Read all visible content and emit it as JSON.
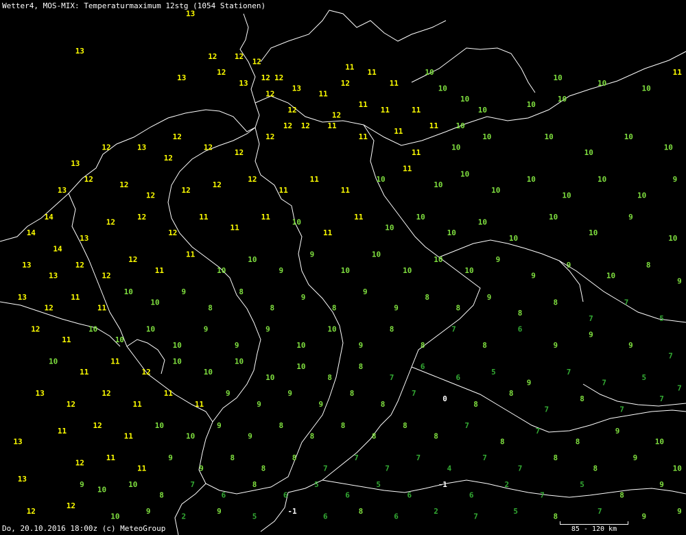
{
  "header": {
    "title": "Wetter4, MOS-MIX: Temperaturmaximum 12stg (1054 Stationen)"
  },
  "footer": {
    "timestamp": "Do, 20.10.2016 18:00z (c) MeteoGroup",
    "scale_label": "85 - 120 km"
  },
  "colors": {
    "background": "#000000",
    "border": "#ffffff",
    "warm": "#ffff00",
    "mild": "#7fdf3f",
    "cool": "#33aa33",
    "cold": "#ffffff"
  },
  "legend_note": "",
  "stations": [
    {
      "lon": 6.2,
      "lat": 55.9,
      "t": 12
    },
    {
      "lon": 7.7,
      "lat": 55.7,
      "t": 13
    },
    {
      "lon": 5.2,
      "lat": 55.0,
      "t": 13
    },
    {
      "lon": 7.5,
      "lat": 54.5,
      "t": 13
    },
    {
      "lon": 8.2,
      "lat": 54.9,
      "t": 12
    },
    {
      "lon": 8.8,
      "lat": 54.9,
      "t": 12
    },
    {
      "lon": 8.4,
      "lat": 54.6,
      "t": 12
    },
    {
      "lon": 8.9,
      "lat": 54.4,
      "t": 13
    },
    {
      "lon": 9.2,
      "lat": 54.8,
      "t": 12
    },
    {
      "lon": 9.4,
      "lat": 54.5,
      "t": 12
    },
    {
      "lon": 9.7,
      "lat": 54.5,
      "t": 12
    },
    {
      "lon": 10.1,
      "lat": 54.3,
      "t": 13
    },
    {
      "lon": 9.5,
      "lat": 54.2,
      "t": 12
    },
    {
      "lon": 10.0,
      "lat": 53.9,
      "t": 12
    },
    {
      "lon": 11.2,
      "lat": 54.4,
      "t": 12
    },
    {
      "lon": 11.0,
      "lat": 53.8,
      "t": 12
    },
    {
      "lon": 11.6,
      "lat": 54.0,
      "t": 11
    },
    {
      "lon": 10.7,
      "lat": 54.2,
      "t": 11
    },
    {
      "lon": 11.3,
      "lat": 54.7,
      "t": 11
    },
    {
      "lon": 11.8,
      "lat": 54.6,
      "t": 11
    },
    {
      "lon": 12.3,
      "lat": 54.4,
      "t": 11
    },
    {
      "lon": 13.1,
      "lat": 54.6,
      "t": 10
    },
    {
      "lon": 13.4,
      "lat": 54.3,
      "t": 10
    },
    {
      "lon": 13.9,
      "lat": 54.1,
      "t": 10
    },
    {
      "lon": 14.3,
      "lat": 53.9,
      "t": 10
    },
    {
      "lon": 12.1,
      "lat": 53.9,
      "t": 11
    },
    {
      "lon": 12.8,
      "lat": 53.9,
      "t": 11
    },
    {
      "lon": 13.2,
      "lat": 53.6,
      "t": 11
    },
    {
      "lon": 12.4,
      "lat": 53.5,
      "t": 11
    },
    {
      "lon": 13.8,
      "lat": 53.6,
      "t": 10
    },
    {
      "lon": 14.4,
      "lat": 53.4,
      "t": 10
    },
    {
      "lon": 13.7,
      "lat": 53.2,
      "t": 10
    },
    {
      "lon": 12.8,
      "lat": 53.1,
      "t": 11
    },
    {
      "lon": 11.6,
      "lat": 53.4,
      "t": 11
    },
    {
      "lon": 10.9,
      "lat": 53.6,
      "t": 11
    },
    {
      "lon": 10.3,
      "lat": 53.6,
      "t": 12
    },
    {
      "lon": 9.9,
      "lat": 53.6,
      "t": 12
    },
    {
      "lon": 9.5,
      "lat": 53.4,
      "t": 12
    },
    {
      "lon": 8.8,
      "lat": 53.1,
      "t": 12
    },
    {
      "lon": 8.1,
      "lat": 53.2,
      "t": 12
    },
    {
      "lon": 7.4,
      "lat": 53.4,
      "t": 12
    },
    {
      "lon": 7.2,
      "lat": 53.0,
      "t": 12
    },
    {
      "lon": 6.6,
      "lat": 53.2,
      "t": 13
    },
    {
      "lon": 5.8,
      "lat": 53.2,
      "t": 12
    },
    {
      "lon": 5.1,
      "lat": 52.9,
      "t": 13
    },
    {
      "lon": 4.8,
      "lat": 52.4,
      "t": 13
    },
    {
      "lon": 5.4,
      "lat": 52.6,
      "t": 12
    },
    {
      "lon": 6.2,
      "lat": 52.5,
      "t": 12
    },
    {
      "lon": 6.8,
      "lat": 52.3,
      "t": 12
    },
    {
      "lon": 7.6,
      "lat": 52.4,
      "t": 12
    },
    {
      "lon": 8.3,
      "lat": 52.5,
      "t": 12
    },
    {
      "lon": 9.1,
      "lat": 52.6,
      "t": 12
    },
    {
      "lon": 9.8,
      "lat": 52.4,
      "t": 11
    },
    {
      "lon": 10.5,
      "lat": 52.6,
      "t": 11
    },
    {
      "lon": 11.2,
      "lat": 52.4,
      "t": 11
    },
    {
      "lon": 12.0,
      "lat": 52.6,
      "t": 10
    },
    {
      "lon": 12.6,
      "lat": 52.8,
      "t": 11
    },
    {
      "lon": 13.3,
      "lat": 52.5,
      "t": 10
    },
    {
      "lon": 13.9,
      "lat": 52.7,
      "t": 10
    },
    {
      "lon": 14.6,
      "lat": 52.4,
      "t": 10
    },
    {
      "lon": 15.4,
      "lat": 52.6,
      "t": 10
    },
    {
      "lon": 16.2,
      "lat": 52.3,
      "t": 10
    },
    {
      "lon": 17.0,
      "lat": 52.6,
      "t": 10
    },
    {
      "lon": 17.9,
      "lat": 52.3,
      "t": 10
    },
    {
      "lon": 18.7,
      "lat": 52.6,
      "t": 9
    },
    {
      "lon": 15.8,
      "lat": 53.4,
      "t": 10
    },
    {
      "lon": 16.7,
      "lat": 53.1,
      "t": 10
    },
    {
      "lon": 17.6,
      "lat": 53.4,
      "t": 10
    },
    {
      "lon": 18.5,
      "lat": 53.2,
      "t": 10
    },
    {
      "lon": 18.9,
      "lat": 53.7,
      "t": 9
    },
    {
      "lon": 16.1,
      "lat": 54.1,
      "t": 10
    },
    {
      "lon": 17.0,
      "lat": 54.4,
      "t": 10
    },
    {
      "lon": 18.0,
      "lat": 54.3,
      "t": 10
    },
    {
      "lon": 18.7,
      "lat": 54.6,
      "t": 11
    },
    {
      "lon": 15.4,
      "lat": 54.0,
      "t": 10
    },
    {
      "lon": 16.0,
      "lat": 54.5,
      "t": 10
    },
    {
      "lon": 4.5,
      "lat": 51.9,
      "t": 14
    },
    {
      "lon": 4.1,
      "lat": 51.6,
      "t": 14
    },
    {
      "lon": 4.7,
      "lat": 51.3,
      "t": 14
    },
    {
      "lon": 5.3,
      "lat": 51.5,
      "t": 13
    },
    {
      "lon": 5.9,
      "lat": 51.8,
      "t": 12
    },
    {
      "lon": 6.6,
      "lat": 51.9,
      "t": 12
    },
    {
      "lon": 7.3,
      "lat": 51.6,
      "t": 12
    },
    {
      "lon": 8.0,
      "lat": 51.9,
      "t": 11
    },
    {
      "lon": 8.7,
      "lat": 51.7,
      "t": 11
    },
    {
      "lon": 9.4,
      "lat": 51.9,
      "t": 11
    },
    {
      "lon": 10.1,
      "lat": 51.8,
      "t": 10
    },
    {
      "lon": 10.8,
      "lat": 51.6,
      "t": 11
    },
    {
      "lon": 11.5,
      "lat": 51.9,
      "t": 11
    },
    {
      "lon": 12.2,
      "lat": 51.7,
      "t": 10
    },
    {
      "lon": 12.9,
      "lat": 51.9,
      "t": 10
    },
    {
      "lon": 13.6,
      "lat": 51.6,
      "t": 10
    },
    {
      "lon": 14.3,
      "lat": 51.8,
      "t": 10
    },
    {
      "lon": 15.0,
      "lat": 51.5,
      "t": 10
    },
    {
      "lon": 15.9,
      "lat": 51.9,
      "t": 10
    },
    {
      "lon": 16.8,
      "lat": 51.6,
      "t": 10
    },
    {
      "lon": 17.7,
      "lat": 51.9,
      "t": 9
    },
    {
      "lon": 18.6,
      "lat": 51.5,
      "t": 10
    },
    {
      "lon": 4.0,
      "lat": 51.0,
      "t": 13
    },
    {
      "lon": 4.6,
      "lat": 50.8,
      "t": 13
    },
    {
      "lon": 5.2,
      "lat": 51.0,
      "t": 12
    },
    {
      "lon": 5.8,
      "lat": 50.8,
      "t": 12
    },
    {
      "lon": 6.4,
      "lat": 51.1,
      "t": 12
    },
    {
      "lon": 7.0,
      "lat": 50.9,
      "t": 11
    },
    {
      "lon": 7.7,
      "lat": 51.2,
      "t": 11
    },
    {
      "lon": 8.4,
      "lat": 50.9,
      "t": 10
    },
    {
      "lon": 9.1,
      "lat": 51.1,
      "t": 10
    },
    {
      "lon": 9.8,
      "lat": 50.9,
      "t": 9
    },
    {
      "lon": 10.5,
      "lat": 51.2,
      "t": 9
    },
    {
      "lon": 11.2,
      "lat": 50.9,
      "t": 10
    },
    {
      "lon": 11.9,
      "lat": 51.2,
      "t": 10
    },
    {
      "lon": 12.6,
      "lat": 50.9,
      "t": 10
    },
    {
      "lon": 13.3,
      "lat": 51.1,
      "t": 10
    },
    {
      "lon": 14.0,
      "lat": 50.9,
      "t": 10
    },
    {
      "lon": 14.7,
      "lat": 51.1,
      "t": 9
    },
    {
      "lon": 15.5,
      "lat": 50.8,
      "t": 9
    },
    {
      "lon": 16.3,
      "lat": 51.0,
      "t": 9
    },
    {
      "lon": 17.2,
      "lat": 50.8,
      "t": 10
    },
    {
      "lon": 18.1,
      "lat": 51.0,
      "t": 8
    },
    {
      "lon": 18.8,
      "lat": 50.7,
      "t": 9
    },
    {
      "lon": 3.9,
      "lat": 50.4,
      "t": 13
    },
    {
      "lon": 4.5,
      "lat": 50.2,
      "t": 12
    },
    {
      "lon": 5.1,
      "lat": 50.4,
      "t": 11
    },
    {
      "lon": 5.7,
      "lat": 50.2,
      "t": 11
    },
    {
      "lon": 6.3,
      "lat": 50.5,
      "t": 10
    },
    {
      "lon": 6.9,
      "lat": 50.3,
      "t": 10
    },
    {
      "lon": 7.6,
      "lat": 50.5,
      "t": 9
    },
    {
      "lon": 8.2,
      "lat": 50.2,
      "t": 8
    },
    {
      "lon": 8.9,
      "lat": 50.5,
      "t": 8
    },
    {
      "lon": 9.6,
      "lat": 50.2,
      "t": 8
    },
    {
      "lon": 10.3,
      "lat": 50.4,
      "t": 9
    },
    {
      "lon": 11.0,
      "lat": 50.2,
      "t": 8
    },
    {
      "lon": 11.7,
      "lat": 50.5,
      "t": 9
    },
    {
      "lon": 12.4,
      "lat": 50.2,
      "t": 9
    },
    {
      "lon": 13.1,
      "lat": 50.4,
      "t": 8
    },
    {
      "lon": 13.8,
      "lat": 50.2,
      "t": 8
    },
    {
      "lon": 14.5,
      "lat": 50.4,
      "t": 9
    },
    {
      "lon": 15.2,
      "lat": 50.1,
      "t": 8
    },
    {
      "lon": 16.0,
      "lat": 50.3,
      "t": 8
    },
    {
      "lon": 16.8,
      "lat": 50.0,
      "t": 7
    },
    {
      "lon": 17.6,
      "lat": 50.3,
      "t": 7
    },
    {
      "lon": 18.4,
      "lat": 50.0,
      "t": 5
    },
    {
      "lon": 18.9,
      "lat": 49.8,
      "t": 7
    },
    {
      "lon": 4.2,
      "lat": 49.8,
      "t": 12
    },
    {
      "lon": 4.9,
      "lat": 49.6,
      "t": 11
    },
    {
      "lon": 5.5,
      "lat": 49.8,
      "t": 10
    },
    {
      "lon": 6.1,
      "lat": 49.6,
      "t": 10
    },
    {
      "lon": 6.8,
      "lat": 49.8,
      "t": 10
    },
    {
      "lon": 7.4,
      "lat": 49.5,
      "t": 10
    },
    {
      "lon": 8.1,
      "lat": 49.8,
      "t": 9
    },
    {
      "lon": 8.8,
      "lat": 49.5,
      "t": 9
    },
    {
      "lon": 9.5,
      "lat": 49.8,
      "t": 9
    },
    {
      "lon": 10.2,
      "lat": 49.5,
      "t": 10
    },
    {
      "lon": 10.9,
      "lat": 49.8,
      "t": 10
    },
    {
      "lon": 11.6,
      "lat": 49.5,
      "t": 9
    },
    {
      "lon": 12.3,
      "lat": 49.8,
      "t": 8
    },
    {
      "lon": 13.0,
      "lat": 49.5,
      "t": 8
    },
    {
      "lon": 13.7,
      "lat": 49.8,
      "t": 7
    },
    {
      "lon": 14.4,
      "lat": 49.5,
      "t": 8
    },
    {
      "lon": 15.2,
      "lat": 49.8,
      "t": 6
    },
    {
      "lon": 16.0,
      "lat": 49.5,
      "t": 9
    },
    {
      "lon": 16.8,
      "lat": 49.7,
      "t": 9
    },
    {
      "lon": 17.7,
      "lat": 49.5,
      "t": 9
    },
    {
      "lon": 18.6,
      "lat": 49.3,
      "t": 7
    },
    {
      "lon": 4.6,
      "lat": 49.2,
      "t": 10
    },
    {
      "lon": 5.3,
      "lat": 49.0,
      "t": 11
    },
    {
      "lon": 6.0,
      "lat": 49.2,
      "t": 11
    },
    {
      "lon": 6.7,
      "lat": 49.0,
      "t": 12
    },
    {
      "lon": 7.4,
      "lat": 49.2,
      "t": 10
    },
    {
      "lon": 8.1,
      "lat": 49.0,
      "t": 10
    },
    {
      "lon": 8.8,
      "lat": 49.2,
      "t": 10
    },
    {
      "lon": 9.5,
      "lat": 48.9,
      "t": 10
    },
    {
      "lon": 10.2,
      "lat": 49.1,
      "t": 10
    },
    {
      "lon": 10.9,
      "lat": 48.9,
      "t": 8
    },
    {
      "lon": 11.6,
      "lat": 49.1,
      "t": 8
    },
    {
      "lon": 12.3,
      "lat": 48.9,
      "t": 7
    },
    {
      "lon": 13.0,
      "lat": 49.1,
      "t": 6
    },
    {
      "lon": 13.8,
      "lat": 48.9,
      "t": 6
    },
    {
      "lon": 14.6,
      "lat": 49.0,
      "t": 5
    },
    {
      "lon": 15.4,
      "lat": 48.8,
      "t": 9
    },
    {
      "lon": 16.3,
      "lat": 49.0,
      "t": 7
    },
    {
      "lon": 17.1,
      "lat": 48.8,
      "t": 7
    },
    {
      "lon": 18.0,
      "lat": 48.9,
      "t": 5
    },
    {
      "lon": 18.8,
      "lat": 48.7,
      "t": 7
    },
    {
      "lon": 4.3,
      "lat": 48.6,
      "t": 13
    },
    {
      "lon": 5.0,
      "lat": 48.4,
      "t": 12
    },
    {
      "lon": 5.8,
      "lat": 48.6,
      "t": 12
    },
    {
      "lon": 6.5,
      "lat": 48.4,
      "t": 11
    },
    {
      "lon": 7.2,
      "lat": 48.6,
      "t": 11
    },
    {
      "lon": 7.9,
      "lat": 48.4,
      "t": 11
    },
    {
      "lon": 8.6,
      "lat": 48.6,
      "t": 9
    },
    {
      "lon": 9.3,
      "lat": 48.4,
      "t": 9
    },
    {
      "lon": 10.0,
      "lat": 48.6,
      "t": 9
    },
    {
      "lon": 10.7,
      "lat": 48.4,
      "t": 9
    },
    {
      "lon": 11.4,
      "lat": 48.6,
      "t": 8
    },
    {
      "lon": 12.1,
      "lat": 48.4,
      "t": 8
    },
    {
      "lon": 12.8,
      "lat": 48.6,
      "t": 7
    },
    {
      "lon": 13.5,
      "lat": 48.5,
      "t": 0
    },
    {
      "lon": 14.2,
      "lat": 48.4,
      "t": 8
    },
    {
      "lon": 15.0,
      "lat": 48.6,
      "t": 8
    },
    {
      "lon": 15.8,
      "lat": 48.3,
      "t": 7
    },
    {
      "lon": 16.6,
      "lat": 48.5,
      "t": 8
    },
    {
      "lon": 17.5,
      "lat": 48.3,
      "t": 7
    },
    {
      "lon": 18.4,
      "lat": 48.5,
      "t": 7
    },
    {
      "lon": 4.8,
      "lat": 47.9,
      "t": 11
    },
    {
      "lon": 5.6,
      "lat": 48.0,
      "t": 12
    },
    {
      "lon": 6.3,
      "lat": 47.8,
      "t": 11
    },
    {
      "lon": 7.0,
      "lat": 48.0,
      "t": 10
    },
    {
      "lon": 7.7,
      "lat": 47.8,
      "t": 10
    },
    {
      "lon": 8.4,
      "lat": 48.0,
      "t": 9
    },
    {
      "lon": 9.1,
      "lat": 47.8,
      "t": 9
    },
    {
      "lon": 9.8,
      "lat": 48.0,
      "t": 8
    },
    {
      "lon": 10.5,
      "lat": 47.8,
      "t": 8
    },
    {
      "lon": 11.2,
      "lat": 48.0,
      "t": 8
    },
    {
      "lon": 11.9,
      "lat": 47.8,
      "t": 8
    },
    {
      "lon": 12.6,
      "lat": 48.0,
      "t": 8
    },
    {
      "lon": 13.3,
      "lat": 47.8,
      "t": 8
    },
    {
      "lon": 14.0,
      "lat": 48.0,
      "t": 7
    },
    {
      "lon": 14.8,
      "lat": 47.7,
      "t": 8
    },
    {
      "lon": 15.6,
      "lat": 47.9,
      "t": 7
    },
    {
      "lon": 16.5,
      "lat": 47.7,
      "t": 8
    },
    {
      "lon": 17.4,
      "lat": 47.9,
      "t": 9
    },
    {
      "lon": 18.3,
      "lat": 47.7,
      "t": 10
    },
    {
      "lon": 18.9,
      "lat": 47.9,
      "t": 9
    },
    {
      "lon": 5.2,
      "lat": 47.3,
      "t": 12
    },
    {
      "lon": 5.9,
      "lat": 47.4,
      "t": 11
    },
    {
      "lon": 6.6,
      "lat": 47.2,
      "t": 11
    },
    {
      "lon": 7.3,
      "lat": 47.4,
      "t": 9
    },
    {
      "lon": 8.0,
      "lat": 47.2,
      "t": 9
    },
    {
      "lon": 8.7,
      "lat": 47.4,
      "t": 8
    },
    {
      "lon": 9.4,
      "lat": 47.2,
      "t": 8
    },
    {
      "lon": 10.1,
      "lat": 47.4,
      "t": 8
    },
    {
      "lon": 10.8,
      "lat": 47.2,
      "t": 7
    },
    {
      "lon": 11.5,
      "lat": 47.4,
      "t": 7
    },
    {
      "lon": 12.2,
      "lat": 47.2,
      "t": 7
    },
    {
      "lon": 12.9,
      "lat": 47.4,
      "t": 7
    },
    {
      "lon": 13.6,
      "lat": 47.2,
      "t": 4
    },
    {
      "lon": 14.4,
      "lat": 47.4,
      "t": 7
    },
    {
      "lon": 15.2,
      "lat": 47.2,
      "t": 7
    },
    {
      "lon": 16.0,
      "lat": 47.4,
      "t": 8
    },
    {
      "lon": 16.9,
      "lat": 47.2,
      "t": 8
    },
    {
      "lon": 17.8,
      "lat": 47.4,
      "t": 9
    },
    {
      "lon": 18.7,
      "lat": 47.2,
      "t": 10
    },
    {
      "lon": 5.7,
      "lat": 46.8,
      "t": 10
    },
    {
      "lon": 6.4,
      "lat": 46.9,
      "t": 10
    },
    {
      "lon": 7.1,
      "lat": 46.7,
      "t": 8
    },
    {
      "lon": 7.8,
      "lat": 46.9,
      "t": 7
    },
    {
      "lon": 8.5,
      "lat": 46.7,
      "t": 6
    },
    {
      "lon": 9.2,
      "lat": 46.9,
      "t": 8
    },
    {
      "lon": 9.9,
      "lat": 46.7,
      "t": 6
    },
    {
      "lon": 10.6,
      "lat": 46.9,
      "t": 5
    },
    {
      "lon": 11.3,
      "lat": 46.7,
      "t": 6
    },
    {
      "lon": 12.0,
      "lat": 46.9,
      "t": 5
    },
    {
      "lon": 12.7,
      "lat": 46.7,
      "t": 6
    },
    {
      "lon": 13.4,
      "lat": 46.9,
      "t": -1
    },
    {
      "lon": 14.1,
      "lat": 46.7,
      "t": 6
    },
    {
      "lon": 14.9,
      "lat": 46.9,
      "t": 2
    },
    {
      "lon": 15.7,
      "lat": 46.7,
      "t": 7
    },
    {
      "lon": 16.6,
      "lat": 46.9,
      "t": 5
    },
    {
      "lon": 17.5,
      "lat": 46.7,
      "t": 8
    },
    {
      "lon": 18.4,
      "lat": 46.9,
      "t": 9
    },
    {
      "lon": 6.0,
      "lat": 46.3,
      "t": 10
    },
    {
      "lon": 6.8,
      "lat": 46.4,
      "t": 9
    },
    {
      "lon": 7.6,
      "lat": 46.3,
      "t": 2
    },
    {
      "lon": 8.4,
      "lat": 46.4,
      "t": 9
    },
    {
      "lon": 9.2,
      "lat": 46.3,
      "t": 5
    },
    {
      "lon": 10.0,
      "lat": 46.4,
      "t": -1
    },
    {
      "lon": 10.8,
      "lat": 46.3,
      "t": 6
    },
    {
      "lon": 11.6,
      "lat": 46.4,
      "t": 8
    },
    {
      "lon": 12.4,
      "lat": 46.3,
      "t": 6
    },
    {
      "lon": 13.3,
      "lat": 46.4,
      "t": 2
    },
    {
      "lon": 14.2,
      "lat": 46.3,
      "t": 7
    },
    {
      "lon": 15.1,
      "lat": 46.4,
      "t": 5
    },
    {
      "lon": 16.0,
      "lat": 46.3,
      "t": 8
    },
    {
      "lon": 17.0,
      "lat": 46.4,
      "t": 7
    },
    {
      "lon": 18.0,
      "lat": 46.3,
      "t": 9
    },
    {
      "lon": 18.8,
      "lat": 46.4,
      "t": 9
    },
    {
      "lon": 3.8,
      "lat": 47.7,
      "t": 13
    },
    {
      "lon": 3.9,
      "lat": 47.0,
      "t": 13
    },
    {
      "lon": 4.1,
      "lat": 46.4,
      "t": 12
    },
    {
      "lon": 5.0,
      "lat": 46.5,
      "t": 12
    },
    {
      "lon": 5.3,
      "lat": 46.9,
      "t": 9
    }
  ]
}
